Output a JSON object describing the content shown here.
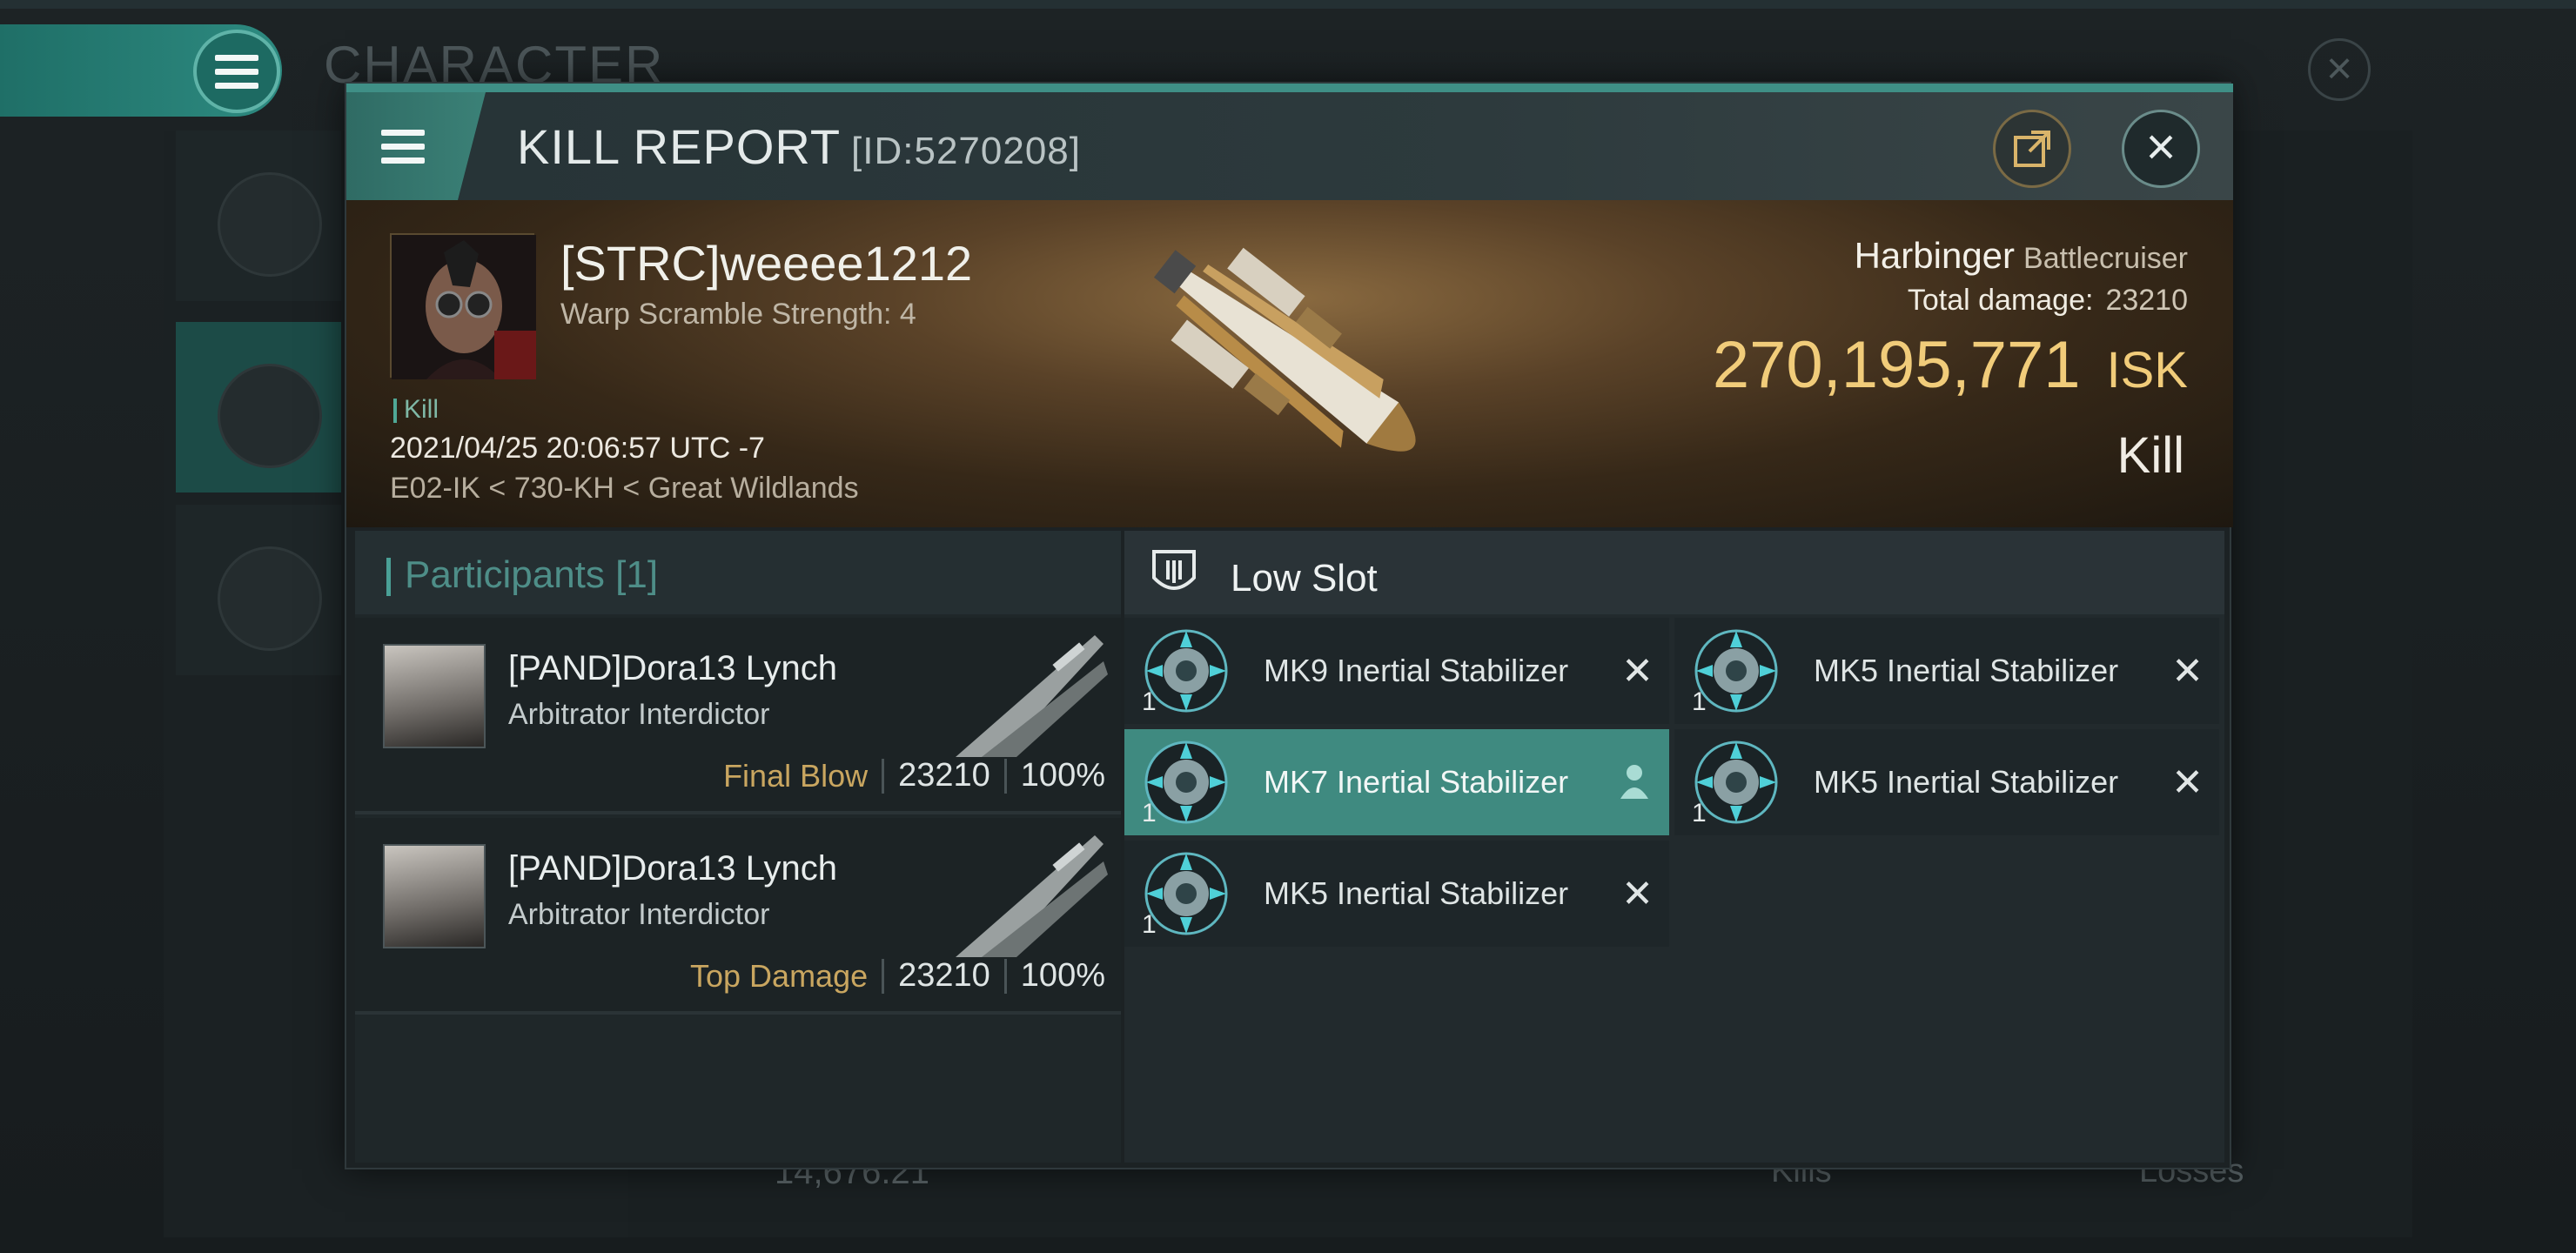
{
  "background": {
    "title": "CHARACTER",
    "bottom_value": "14,676.21",
    "bottom_kills": "Kills",
    "bottom_losses": "Losses"
  },
  "window": {
    "title": "KILL REPORT",
    "report_id": "[ID:5270208]"
  },
  "victim": {
    "name": "[STRC]weeee1212",
    "warp_scramble": "Warp Scramble Strength: 4",
    "tag": "Kill",
    "datetime": "2021/04/25 20:06:57 UTC -7",
    "location": "E02-IK < 730-KH < Great Wildlands",
    "ship_name": "Harbinger",
    "ship_class": "Battlecruiser",
    "total_damage_label": "Total damage:",
    "total_damage_value": "23210",
    "isk_value": "270,195,771",
    "isk_unit": "ISK",
    "result": "Kill"
  },
  "participants": {
    "header": "Participants",
    "count": "[1]",
    "rows": [
      {
        "name": "[PAND]Dora13 Lynch",
        "ship": "Arbitrator Interdictor",
        "role": "Final Blow",
        "damage": "23210",
        "percent": "100%"
      },
      {
        "name": "[PAND]Dora13 Lynch",
        "ship": "Arbitrator Interdictor",
        "role": "Top Damage",
        "damage": "23210",
        "percent": "100%"
      }
    ]
  },
  "low_slot": {
    "title": "Low Slot",
    "items": [
      {
        "name": "MK9 Inertial Stabilizer",
        "qty": "1",
        "status": "destroyed"
      },
      {
        "name": "MK5 Inertial Stabilizer",
        "qty": "1",
        "status": "destroyed"
      },
      {
        "name": "MK7 Inertial Stabilizer",
        "qty": "1",
        "status": "dropped"
      },
      {
        "name": "MK5 Inertial Stabilizer",
        "qty": "1",
        "status": "destroyed"
      },
      {
        "name": "MK5 Inertial Stabilizer",
        "qty": "1",
        "status": "destroyed"
      }
    ]
  },
  "colors": {
    "accent": "#3f8a80",
    "isk": "#f1cc7a",
    "role": "#c9a660"
  }
}
